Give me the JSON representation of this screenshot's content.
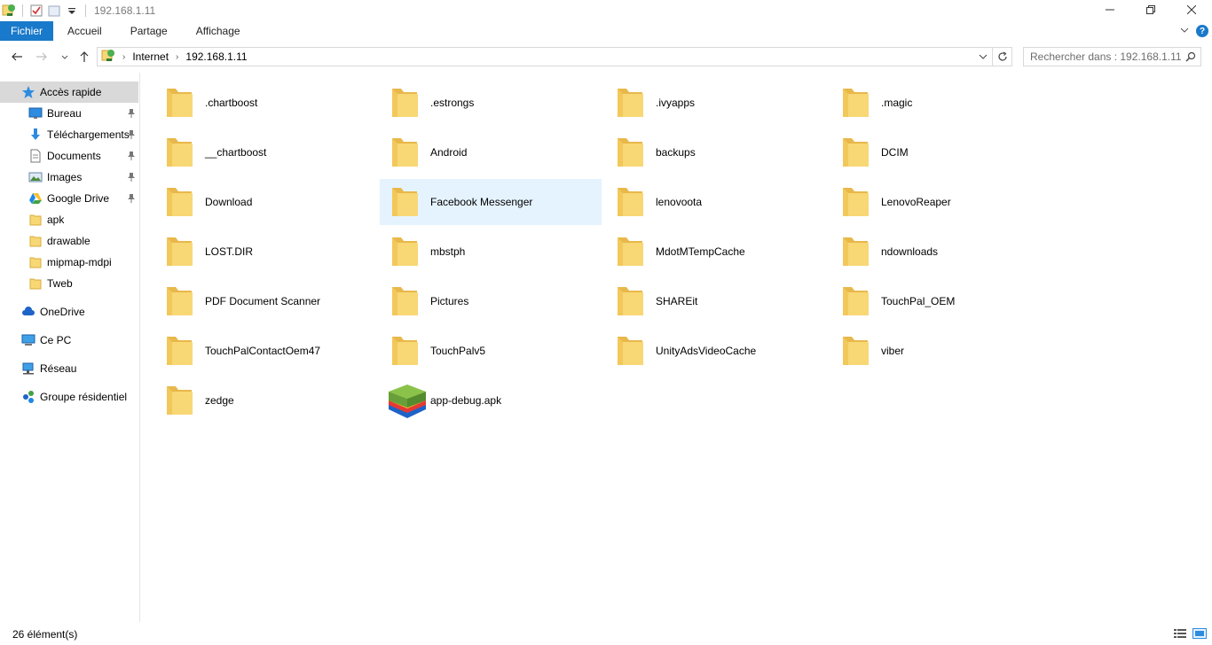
{
  "window": {
    "title": "192.168.1.11",
    "controls": {
      "minimize": "—",
      "restore": "❐",
      "close": "✕"
    }
  },
  "ribbon": {
    "tabs": [
      "Fichier",
      "Accueil",
      "Partage",
      "Affichage"
    ]
  },
  "address": {
    "crumbs": [
      "Internet",
      "192.168.1.11"
    ],
    "search_placeholder": "Rechercher dans : 192.168.1.11"
  },
  "sidebar": {
    "quick_access": {
      "label": "Accès rapide",
      "icon": "star-icon"
    },
    "pinned": [
      {
        "label": "Bureau",
        "icon": "desktop-icon",
        "pinned": true
      },
      {
        "label": "Téléchargements",
        "icon": "download-icon",
        "pinned": true
      },
      {
        "label": "Documents",
        "icon": "document-icon",
        "pinned": true
      },
      {
        "label": "Images",
        "icon": "pictures-icon",
        "pinned": true
      },
      {
        "label": "Google Drive",
        "icon": "google-drive-icon",
        "pinned": true
      },
      {
        "label": "apk",
        "icon": "folder-icon",
        "pinned": false
      },
      {
        "label": "drawable",
        "icon": "folder-icon",
        "pinned": false
      },
      {
        "label": "mipmap-mdpi",
        "icon": "folder-icon",
        "pinned": false
      },
      {
        "label": "Tweb",
        "icon": "folder-icon",
        "pinned": false
      }
    ],
    "roots": [
      {
        "label": "OneDrive",
        "icon": "cloud-icon"
      },
      {
        "label": "Ce PC",
        "icon": "computer-icon"
      },
      {
        "label": "Réseau",
        "icon": "network-icon"
      },
      {
        "label": "Groupe résidentiel",
        "icon": "homegroup-icon"
      }
    ]
  },
  "items": [
    {
      "name": ".chartboost",
      "type": "folder"
    },
    {
      "name": ".estrongs",
      "type": "folder"
    },
    {
      "name": ".ivyapps",
      "type": "folder"
    },
    {
      "name": ".magic",
      "type": "folder"
    },
    {
      "name": "__chartboost",
      "type": "folder"
    },
    {
      "name": "Android",
      "type": "folder"
    },
    {
      "name": "backups",
      "type": "folder"
    },
    {
      "name": "DCIM",
      "type": "folder"
    },
    {
      "name": "Download",
      "type": "folder"
    },
    {
      "name": "Facebook Messenger",
      "type": "folder",
      "selected": true
    },
    {
      "name": "lenovoota",
      "type": "folder"
    },
    {
      "name": "LenovoReaper",
      "type": "folder"
    },
    {
      "name": "LOST.DIR",
      "type": "folder"
    },
    {
      "name": "mbstph",
      "type": "folder"
    },
    {
      "name": "MdotMTempCache",
      "type": "folder"
    },
    {
      "name": "ndownloads",
      "type": "folder"
    },
    {
      "name": "PDF Document Scanner",
      "type": "folder"
    },
    {
      "name": "Pictures",
      "type": "folder"
    },
    {
      "name": "SHAREit",
      "type": "folder"
    },
    {
      "name": "TouchPal_OEM",
      "type": "folder"
    },
    {
      "name": "TouchPalContactOem47",
      "type": "folder"
    },
    {
      "name": "TouchPalv5",
      "type": "folder"
    },
    {
      "name": "UnityAdsVideoCache",
      "type": "folder"
    },
    {
      "name": "viber",
      "type": "folder"
    },
    {
      "name": "zedge",
      "type": "folder"
    },
    {
      "name": "app-debug.apk",
      "type": "apk"
    }
  ],
  "status": {
    "count": "26 élément(s)"
  },
  "colors": {
    "accent": "#1979ca",
    "folder": "#f8d775",
    "folder_dark": "#e8b84a",
    "selection": "#e5f3ff"
  }
}
